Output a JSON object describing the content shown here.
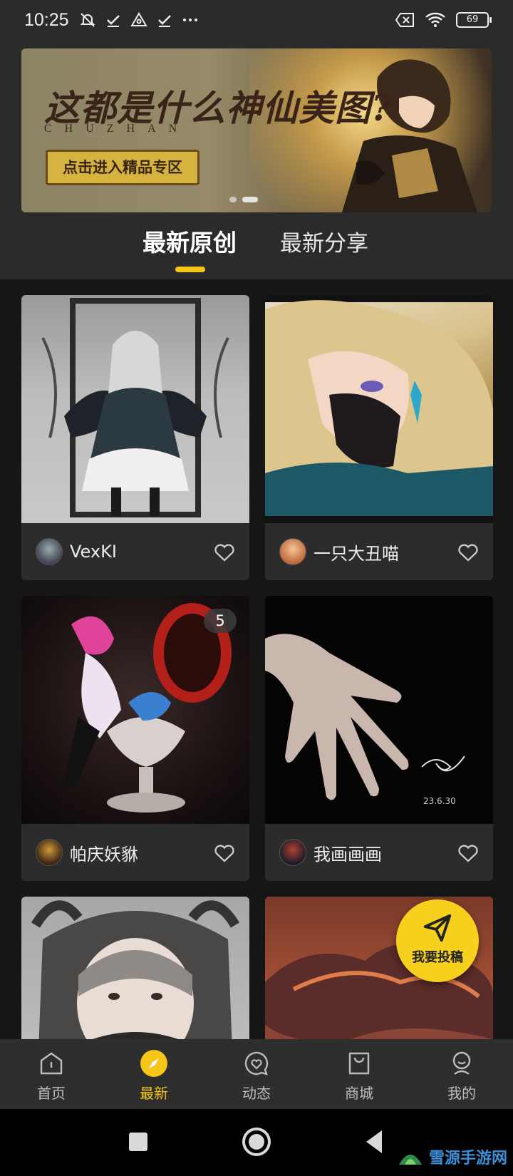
{
  "status_bar": {
    "time": "10:25",
    "battery": "69"
  },
  "banner": {
    "title": "这都是什么神仙美图?",
    "subtitle": "CHUZHAN",
    "button_label": "点击进入精品专区"
  },
  "tabs": [
    {
      "label": "最新原创",
      "active": true
    },
    {
      "label": "最新分享",
      "active": false
    }
  ],
  "posts": [
    {
      "author": "VexKI",
      "image": "gothic-doll-illustration",
      "badge": ""
    },
    {
      "author": "一只大丑喵",
      "image": "blond-boy-illustration",
      "badge": ""
    },
    {
      "author": "帕庆妖貅",
      "image": "figure-photo",
      "badge": "5"
    },
    {
      "author": "我画画画",
      "image": "hand-drawing",
      "badge": ""
    },
    {
      "author": "",
      "image": "hooded-girl-photo",
      "badge": ""
    },
    {
      "author": "",
      "image": "sunset-cloud-painting",
      "badge": ""
    }
  ],
  "fab": {
    "label": "我要投稿",
    "icon": "paper-plane-icon"
  },
  "bottom_nav": [
    {
      "label": "首页",
      "icon": "home-icon",
      "active": false
    },
    {
      "label": "最新",
      "icon": "compass-icon",
      "active": true
    },
    {
      "label": "动态",
      "icon": "heart-bubble-icon",
      "active": false
    },
    {
      "label": "商城",
      "icon": "shopping-bag-icon",
      "active": false
    },
    {
      "label": "我的",
      "icon": "profile-icon",
      "active": false
    }
  ],
  "watermark": {
    "text": "雪源手游网"
  },
  "colors": {
    "accent": "#f5c518",
    "background": "#161616",
    "surface": "#2c2c2c"
  }
}
